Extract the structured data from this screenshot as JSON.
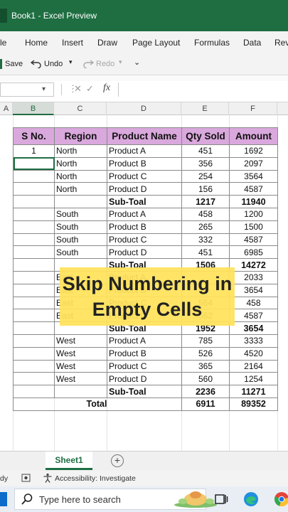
{
  "window": {
    "title": "Book1  -  Excel Preview"
  },
  "menu": [
    "le",
    "Home",
    "Insert",
    "Draw",
    "Page Layout",
    "Formulas",
    "Data",
    "Rev"
  ],
  "qat": {
    "save": "Save",
    "undo": "Undo",
    "redo": "Redo"
  },
  "formula_bar": {
    "fx": "fx"
  },
  "columns": [
    "A",
    "B",
    "C",
    "D",
    "E",
    "F"
  ],
  "table": {
    "headers": [
      "S No.",
      "Region",
      "Product Name",
      "Qty Sold",
      "Amount"
    ],
    "rows": [
      [
        "1",
        "North",
        "Product A",
        "451",
        "1692"
      ],
      [
        "",
        "North",
        "Product B",
        "356",
        "2097"
      ],
      [
        "",
        "North",
        "Product C",
        "254",
        "3564"
      ],
      [
        "",
        "North",
        "Product D",
        "156",
        "4587"
      ],
      [
        "",
        "",
        "Sub-Toal",
        "1217",
        "11940"
      ],
      [
        "",
        "South",
        "Product A",
        "458",
        "1200"
      ],
      [
        "",
        "South",
        "Product B",
        "265",
        "1500"
      ],
      [
        "",
        "South",
        "Product C",
        "332",
        "4587"
      ],
      [
        "",
        "South",
        "Product D",
        "451",
        "6985"
      ],
      [
        "",
        "",
        "Sub-Toal",
        "1506",
        "14272"
      ],
      [
        "",
        "East",
        "Product A",
        "",
        "2033"
      ],
      [
        "",
        "East",
        "Product B",
        "",
        "3654"
      ],
      [
        "",
        "East",
        "Product C",
        "564",
        "458"
      ],
      [
        "",
        "East",
        "Product D",
        "562",
        "4587"
      ],
      [
        "",
        "",
        "Sub-Toal",
        "1952",
        "3654"
      ],
      [
        "",
        "West",
        "Product A",
        "785",
        "3333"
      ],
      [
        "",
        "West",
        "Product B",
        "526",
        "4520"
      ],
      [
        "",
        "West",
        "Product C",
        "365",
        "2164"
      ],
      [
        "",
        "West",
        "Product D",
        "560",
        "1254"
      ],
      [
        "",
        "",
        "Sub-Toal",
        "2236",
        "11271"
      ]
    ],
    "total": {
      "label": "Total",
      "qty": "6911",
      "amount": "89352"
    }
  },
  "overlay": {
    "line1": "Skip Numbering in",
    "line2": "Empty Cells"
  },
  "sheet_tab": "Sheet1",
  "status": {
    "ready": "dy",
    "accessibility": "Accessibility: Investigate"
  },
  "taskbar": {
    "search_placeholder": "Type here to search"
  },
  "colors": {
    "excel_green": "#1e6e42",
    "header_fill": "#d9a8dc",
    "overlay_fill": "#ffe25a"
  }
}
